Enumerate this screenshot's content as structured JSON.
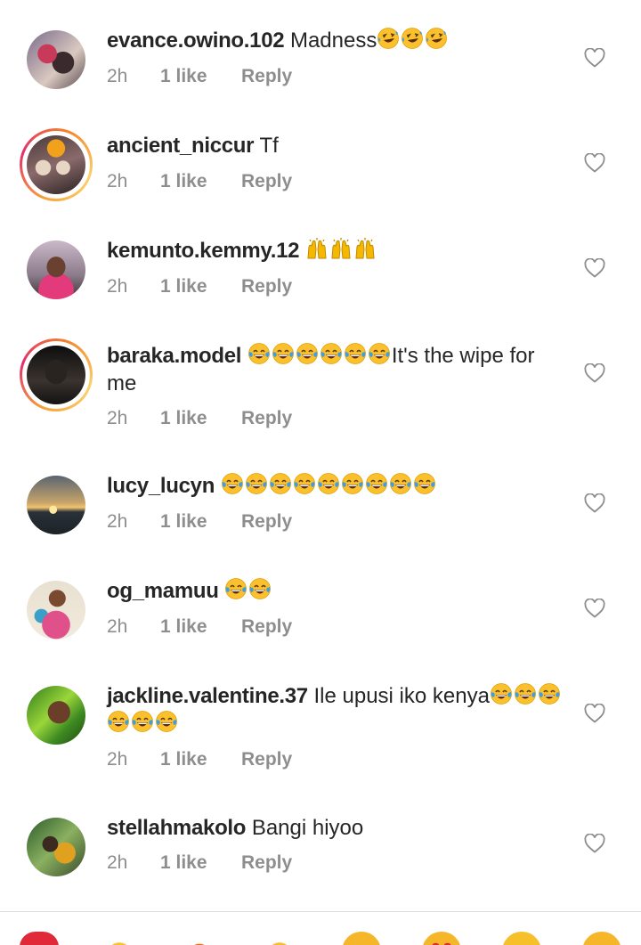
{
  "comments": [
    {
      "username": "evance.owino.102",
      "text": " Madness",
      "emoji": "rofl",
      "emoji_count": 3,
      "time": "2h",
      "likes": "1 like",
      "reply": "Reply",
      "story": false
    },
    {
      "username": "ancient_niccur",
      "text": " Tf",
      "emoji": "",
      "emoji_count": 0,
      "time": "2h",
      "likes": "1 like",
      "reply": "Reply",
      "story": true
    },
    {
      "username": "kemunto.kemmy.12",
      "text": " ",
      "emoji": "raised-hands",
      "emoji_count": 3,
      "time": "2h",
      "likes": "1 like",
      "reply": "Reply",
      "story": false
    },
    {
      "username": "baraka.model",
      "text": "It's the wipe for me",
      "emoji": "joy",
      "emoji_count": 6,
      "time": "2h",
      "likes": "1 like",
      "reply": "Reply",
      "story": true
    },
    {
      "username": "lucy_lucyn",
      "text": " ",
      "emoji": "joy",
      "emoji_count": 9,
      "time": "2h",
      "likes": "1 like",
      "reply": "Reply",
      "story": false
    },
    {
      "username": "og_mamuu",
      "text": " ",
      "emoji": "joy",
      "emoji_count": 2,
      "time": "2h",
      "likes": "1 like",
      "reply": "Reply",
      "story": false
    },
    {
      "username": "jackline.valentine.37",
      "text": " Ile upusi iko kenya",
      "emoji": "joy",
      "emoji_count": 6,
      "time": "2h",
      "likes": "1 like",
      "reply": "Reply",
      "story": false
    },
    {
      "username": "stellahmakolo",
      "text": " Bangi hiyoo",
      "emoji": "",
      "emoji_count": 0,
      "time": "2h",
      "likes": "1 like",
      "reply": "Reply",
      "story": false
    }
  ],
  "quick_reactions": [
    "heart-emoji",
    "raised-hands-emoji",
    "fire-emoji",
    "clap-emoji",
    "crying-emoji",
    "heart-eyes-emoji",
    "wow-emoji",
    "joy-emoji"
  ],
  "colors": {
    "username": "#262626",
    "meta": "#8e8e8e",
    "divider": "#dbdbdb",
    "story_ring": "#e1306c"
  }
}
